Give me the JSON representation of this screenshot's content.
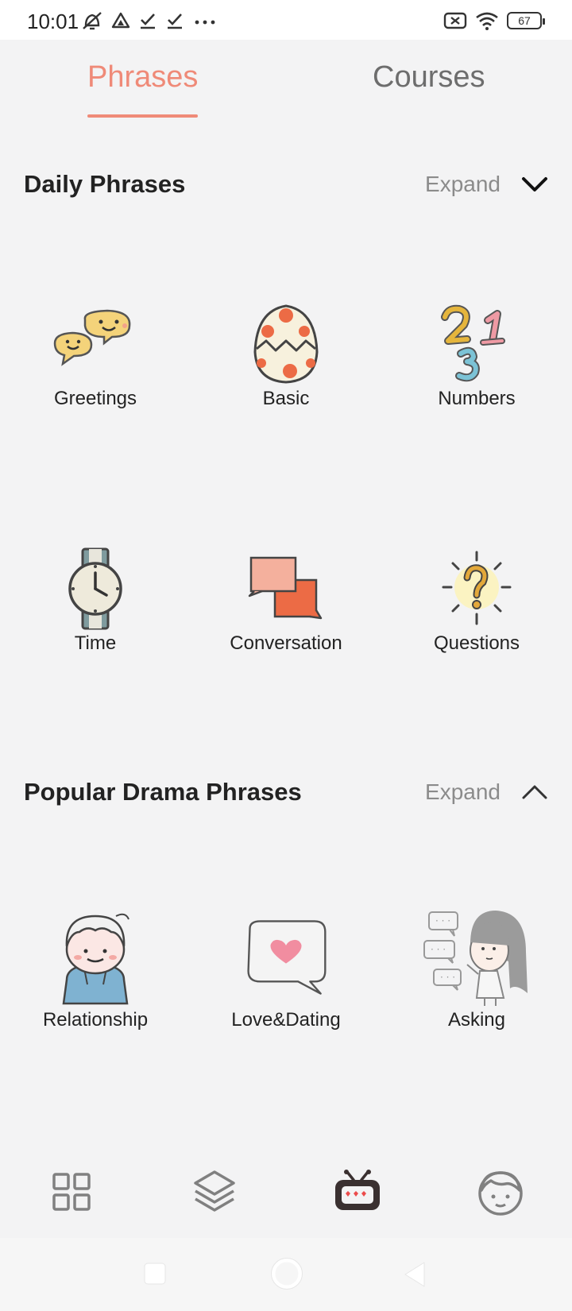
{
  "status_bar": {
    "time": "10:01",
    "battery": "67",
    "left_icons": [
      "mute-icon",
      "drive-icon",
      "check-icon",
      "check-icon",
      "more-icon"
    ],
    "right_icons": [
      "sim-x-icon",
      "wifi-icon",
      "battery-icon"
    ]
  },
  "tabs": [
    {
      "label": "Phrases",
      "active": true
    },
    {
      "label": "Courses",
      "active": false
    }
  ],
  "accent_color": "#ef8a78",
  "sections": {
    "daily": {
      "title": "Daily Phrases",
      "expand_label": "Expand",
      "chevron": "chevron-down-icon",
      "items": [
        {
          "label": "Greetings",
          "icon": "greetings-icon"
        },
        {
          "label": "Basic",
          "icon": "egg-icon"
        },
        {
          "label": "Numbers",
          "icon": "numbers-icon"
        },
        {
          "label": "Time",
          "icon": "watch-icon"
        },
        {
          "label": "Conversation",
          "icon": "conversation-icon"
        },
        {
          "label": "Questions",
          "icon": "question-icon"
        }
      ]
    },
    "drama": {
      "title": "Popular Drama Phrases",
      "expand_label": "Expand",
      "chevron": "chevron-up-icon",
      "items": [
        {
          "label": "Relationship",
          "icon": "boy-hoodie-icon"
        },
        {
          "label": "Love&Dating",
          "icon": "heart-bubble-icon"
        },
        {
          "label": "Asking",
          "icon": "girl-asking-icon"
        }
      ]
    }
  },
  "bottom_nav": [
    "grid-icon",
    "layers-icon",
    "tv-icon",
    "profile-face-icon"
  ],
  "system_nav": [
    "recents-square-icon",
    "home-circle-icon",
    "back-triangle-icon"
  ]
}
